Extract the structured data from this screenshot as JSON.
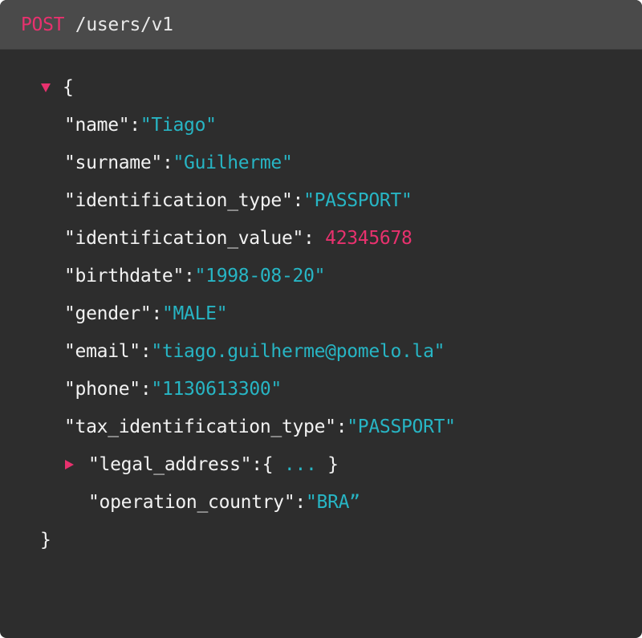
{
  "request": {
    "method": "POST",
    "path": "/users/v1"
  },
  "icons": {
    "expanded": "caret-down-icon",
    "collapsed": "caret-right-icon"
  },
  "colors": {
    "panel_bg": "#2d2d2d",
    "header_bg": "#4a4a4a",
    "method": "#e8316e",
    "string_value": "#27b5c4",
    "number_value": "#e8316e",
    "key": "#f2f2f2"
  },
  "json": {
    "open_brace": "{",
    "close_brace": "}",
    "fields": [
      {
        "key": "\"name\"",
        "sep": ":",
        "value": "\"Tiago\""
      },
      {
        "key": "\"surname\"",
        "sep": ":",
        "value": "\"Guilherme\""
      },
      {
        "key": "\"identification_type\"",
        "sep": ":",
        "value": "\"PASSPORT\""
      },
      {
        "key": "\"identification_value\"",
        "sep": ": ",
        "value": "42345678"
      },
      {
        "key": "\"birthdate\"",
        "sep": ":",
        "value": "\"1998-08-20\""
      },
      {
        "key": "\"gender\"",
        "sep": ":",
        "value": "\"MALE\""
      },
      {
        "key": "\"email\"",
        "sep": ":",
        "value": "\"tiago.guilherme@pomelo.la\""
      },
      {
        "key": "\"phone\"",
        "sep": ":",
        "value": "\"1130613300\""
      },
      {
        "key": "\"tax_identification_type\"",
        "sep": ":",
        "value": "\"PASSPORT\""
      }
    ],
    "legal_address": {
      "key": "\"legal_address\"",
      "sep": ":",
      "open": "{ ",
      "ellipsis": "...",
      "close": " }"
    },
    "operation_country": {
      "key": "\"operation_country\"",
      "sep": ":",
      "value": "\"BRA”"
    }
  }
}
